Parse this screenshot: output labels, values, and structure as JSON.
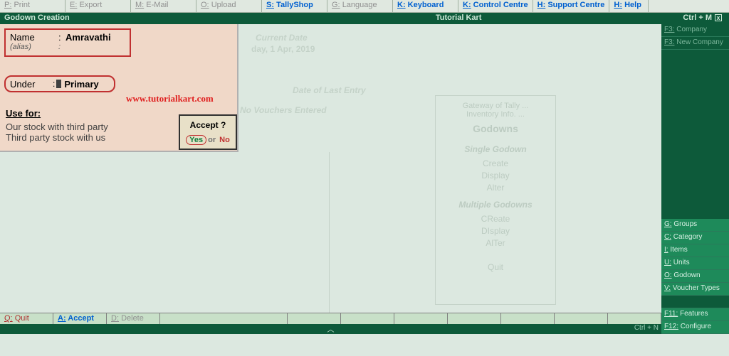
{
  "top_menu": {
    "print": {
      "key": "P:",
      "label": "Print"
    },
    "export_": {
      "key": "E:",
      "label": "Export"
    },
    "email": {
      "key": "M:",
      "label": "E-Mail"
    },
    "upload": {
      "key": "O:",
      "label": "Upload"
    },
    "tallyshop": {
      "key": "S:",
      "label": "TallyShop"
    },
    "language": {
      "key": "G:",
      "label": "Language"
    },
    "keyboard": {
      "key": "K:",
      "label": "Keyboard"
    },
    "control": {
      "key": "K:",
      "label": "Control Centre"
    },
    "support": {
      "key": "H:",
      "label": "Support Centre"
    },
    "help": {
      "key": "H:",
      "label": "Help"
    }
  },
  "title": {
    "left": "Godown Creation",
    "center": "Tutorial Kart",
    "right": "Ctrl + M"
  },
  "form": {
    "name_label": "Name",
    "name_value": "Amravathi",
    "alias_label": "(alias)",
    "under_label": "Under",
    "under_value": "Primary",
    "usefor_head": "Use for:",
    "usefor_line1": "Our stock with third party",
    "usefor_line2": "Third party stock with us"
  },
  "accept": {
    "title": "Accept ?",
    "yes": "Yes",
    "or": "or",
    "no": "No"
  },
  "watermark": "www.tutorialkart.com",
  "background": {
    "field1": "Current Date",
    "field2": "day, 1 Apr, 2019",
    "field3": "Date of Last Entry",
    "field4": "No Vouchers Entered"
  },
  "menu": {
    "gateway": "Gateway of Tally ...",
    "inventory": "Inventory Info. ...",
    "title": "Godowns",
    "single": "Single Godown",
    "create": "Create",
    "display": "Display",
    "alter": "Alter",
    "multiple": "Multiple Godowns",
    "mcreate": "CReate",
    "mdisplay": "DIsplay",
    "malter": "AlTer",
    "quit": "Quit"
  },
  "bottom": {
    "quit": {
      "key": "Q:",
      "label": "Quit"
    },
    "accept": {
      "key": "A:",
      "label": "Accept"
    },
    "delete_": {
      "key": "D:",
      "label": "Delete"
    }
  },
  "sidebar": {
    "company": {
      "key": "F3:",
      "label": "Company"
    },
    "newcompany": {
      "key": "F3:",
      "label": "New Company"
    },
    "groups": {
      "key": "G:",
      "label": "Groups"
    },
    "category": {
      "key": "C:",
      "label": "Category"
    },
    "items": {
      "key": "I:",
      "label": "Items"
    },
    "units": {
      "key": "U:",
      "label": "Units"
    },
    "godown": {
      "key": "O:",
      "label": "Godown"
    },
    "voucher": {
      "key": "V:",
      "label": "Voucher Types"
    },
    "features": {
      "key": "F11:",
      "label": "Features"
    },
    "configure": {
      "key": "F12:",
      "label": "Configure"
    }
  },
  "scroll": {
    "label": "Ctrl + N"
  }
}
